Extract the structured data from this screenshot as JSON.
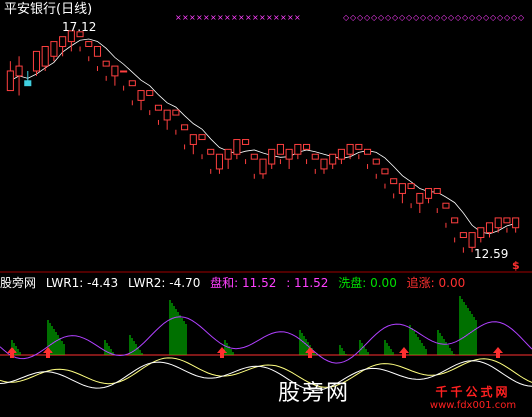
{
  "title": "平安银行(日线)",
  "high_label": "17.12",
  "low_label": "12.59",
  "dollar_mark": "$",
  "sub_header": {
    "name": "股旁网",
    "lwr1": "LWR1: -4.43",
    "lwr2": "LWR2: -4.70",
    "panhe_label": "盘和: 11.52",
    "panhe_value": ": 11.52",
    "xipan": "洗盘: 0.00",
    "zhuizhang": "追涨: 0.00"
  },
  "watermark": "股旁网",
  "site": {
    "title": "千千公式网",
    "url": "www.fdx001.com"
  },
  "colors": {
    "up": "#ff4040",
    "down": "#40d0e0",
    "ma": "#ffffff",
    "marker": "#ff40ff",
    "green": "#00e000",
    "red": "#ff3030",
    "yellow": "#ffff80",
    "purple": "#b040ff"
  },
  "chart_data": {
    "type": "candlestick",
    "high_price": 17.12,
    "low_price": 12.59,
    "candles": [
      [
        15.9,
        16.3,
        16.1,
        16.5
      ],
      [
        16.2,
        16.4,
        15.8,
        16.6
      ],
      [
        16.1,
        16.0,
        16.3,
        16.1
      ],
      [
        16.3,
        16.7,
        16.2,
        16.5
      ],
      [
        16.4,
        16.8,
        16.3,
        16.7
      ],
      [
        16.6,
        16.9,
        16.5,
        16.8
      ],
      [
        16.8,
        17.0,
        16.6,
        16.9
      ],
      [
        16.9,
        17.12,
        16.7,
        17.0
      ],
      [
        17.0,
        17.1,
        16.7,
        16.8
      ],
      [
        16.8,
        16.9,
        16.5,
        16.6
      ],
      [
        16.6,
        16.8,
        16.3,
        16.4
      ],
      [
        16.4,
        16.5,
        16.1,
        16.2
      ],
      [
        16.2,
        16.4,
        16.0,
        16.3
      ],
      [
        16.3,
        16.3,
        15.9,
        16.0
      ],
      [
        16.0,
        16.1,
        15.6,
        15.7
      ],
      [
        15.7,
        15.9,
        15.5,
        15.8
      ],
      [
        15.8,
        15.9,
        15.4,
        15.5
      ],
      [
        15.5,
        15.6,
        15.2,
        15.3
      ],
      [
        15.3,
        15.5,
        15.1,
        15.4
      ],
      [
        15.4,
        15.5,
        15.0,
        15.1
      ],
      [
        15.1,
        15.2,
        14.7,
        14.8
      ],
      [
        14.8,
        15.0,
        14.6,
        14.9
      ],
      [
        14.9,
        15.0,
        14.5,
        14.6
      ],
      [
        14.6,
        14.7,
        14.2,
        14.3
      ],
      [
        14.3,
        14.6,
        14.2,
        14.5
      ],
      [
        14.5,
        14.7,
        14.3,
        14.6
      ],
      [
        14.6,
        14.9,
        14.5,
        14.8
      ],
      [
        14.8,
        14.9,
        14.4,
        14.5
      ],
      [
        14.5,
        14.6,
        14.1,
        14.2
      ],
      [
        14.2,
        14.5,
        14.1,
        14.4
      ],
      [
        14.4,
        14.7,
        14.3,
        14.6
      ],
      [
        14.6,
        14.8,
        14.4,
        14.5
      ],
      [
        14.5,
        14.7,
        14.3,
        14.6
      ],
      [
        14.6,
        14.8,
        14.5,
        14.7
      ],
      [
        14.7,
        14.8,
        14.4,
        14.5
      ],
      [
        14.5,
        14.6,
        14.2,
        14.3
      ],
      [
        14.3,
        14.5,
        14.2,
        14.4
      ],
      [
        14.4,
        14.6,
        14.3,
        14.5
      ],
      [
        14.5,
        14.7,
        14.4,
        14.6
      ],
      [
        14.6,
        14.8,
        14.5,
        14.7
      ],
      [
        14.7,
        14.8,
        14.5,
        14.6
      ],
      [
        14.6,
        14.7,
        14.3,
        14.4
      ],
      [
        14.4,
        14.5,
        14.1,
        14.2
      ],
      [
        14.2,
        14.3,
        13.9,
        14.0
      ],
      [
        14.0,
        14.1,
        13.7,
        13.8
      ],
      [
        13.8,
        14.0,
        13.6,
        13.9
      ],
      [
        13.9,
        14.0,
        13.5,
        13.6
      ],
      [
        13.6,
        13.8,
        13.4,
        13.7
      ],
      [
        13.7,
        13.9,
        13.6,
        13.8
      ],
      [
        13.8,
        13.9,
        13.4,
        13.5
      ],
      [
        13.5,
        13.6,
        13.1,
        13.2
      ],
      [
        13.2,
        13.3,
        12.8,
        12.9
      ],
      [
        12.9,
        13.0,
        12.59,
        12.7
      ],
      [
        12.7,
        13.0,
        12.6,
        12.9
      ],
      [
        12.9,
        13.1,
        12.8,
        13.0
      ],
      [
        13.0,
        13.2,
        12.9,
        13.1
      ],
      [
        13.1,
        13.3,
        13.0,
        13.2
      ],
      [
        13.2,
        13.3,
        13.0,
        13.1
      ],
      [
        13.1,
        13.3,
        13.0,
        13.2
      ]
    ]
  }
}
